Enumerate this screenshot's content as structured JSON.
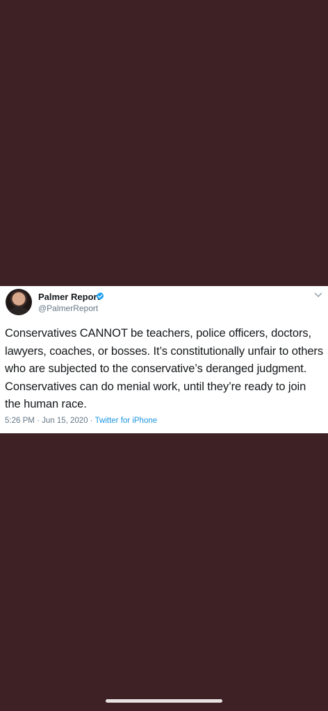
{
  "tweet": {
    "display_name": "Palmer Report",
    "handle": "@PalmerReport",
    "text": "Conservatives CANNOT be teachers, police officers, doctors, lawyers, coaches, or bosses. It’s constitutionally unfair to others who are subjected to the conservative’s deranged judgment. Conservatives can do menial work, until they’re ready to join the human race.",
    "time": "5:26 PM",
    "date": "Jun 15, 2020",
    "source": "Twitter for iPhone",
    "separator": "·",
    "verified": true
  },
  "colors": {
    "background": "#3d2124",
    "card": "#ffffff",
    "verified_badge": "#1da1f2",
    "link": "#1b95e0",
    "secondary_text": "#657786"
  },
  "icons": {
    "verified": "verified-badge-icon",
    "menu": "chevron-down-icon"
  }
}
